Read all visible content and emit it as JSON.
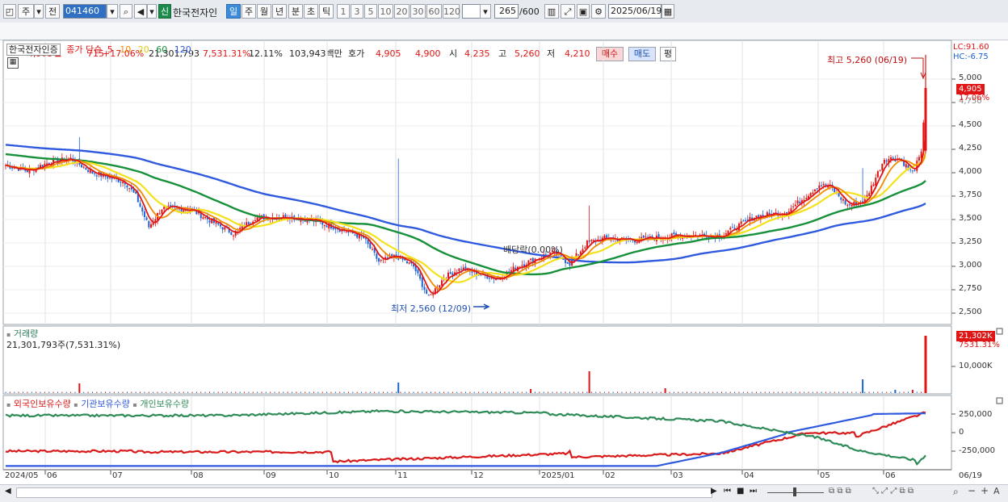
{
  "toolbar": {
    "period_day": "주",
    "prev": "전",
    "code": "041460",
    "new_badge": "신",
    "stock_name": "한국전자인",
    "periods": [
      "일",
      "주",
      "월",
      "년",
      "분",
      "초",
      "틱"
    ],
    "intervals": [
      "1",
      "3",
      "5",
      "10",
      "20",
      "30",
      "60",
      "120"
    ],
    "count": "265",
    "count_total": "/600",
    "date": "2025/06/19"
  },
  "quote": {
    "price": "4,905",
    "change": "715",
    "change_pct": "+17.06%",
    "volume": "21,301,793",
    "vol_ratio": "7,531.31%",
    "turnover": "12.11%",
    "amount": "103,943백만",
    "bid_label": "호가",
    "bid1": "4,905",
    "bid2": "4,900",
    "open_label": "시",
    "open": "4,235",
    "high_label": "고",
    "high": "5,260",
    "low_label": "저",
    "low": "4,210",
    "buy_label": "매수",
    "sell_label": "매도",
    "eval_label": "평"
  },
  "price_panel": {
    "name": "한국전자인증",
    "ma_label": "종가 단순",
    "ma_periods": [
      "5",
      "10",
      "20",
      "60",
      "120"
    ],
    "lc": "LC:91.60",
    "hc": "HC:-6.75",
    "high_note": "최고 5,260 (06/19)",
    "low_note": "최저 2,560 (12/09)",
    "dividend_note": "배당락(0.00%)",
    "cur_price_badge": "4,905",
    "cur_pct_badge": "17.06%",
    "y_ticks": [
      "5,000",
      "4,750",
      "4,500",
      "4,250",
      "4,000",
      "3,750",
      "3,500",
      "3,250",
      "3,000",
      "2,750",
      "2,500"
    ],
    "hidden_tick": "4,750"
  },
  "volume_panel": {
    "title": "거래량",
    "value": "21,301,793주(7,531.31%)",
    "badge_top": "21,302K",
    "badge_pct": "7531.31%",
    "y_tick": "10,000K"
  },
  "holding_panel": {
    "legend": [
      "외국인보유수량",
      "기관보유수량",
      "개인보유수량"
    ],
    "y_ticks": [
      "250,000",
      "0",
      "-250,000"
    ]
  },
  "x_axis": {
    "labels": [
      "2024/05",
      "06",
      "07",
      "08",
      "09",
      "10",
      "11",
      "12",
      "2025/01",
      "02",
      "03",
      "04",
      "05",
      "06",
      "06/19"
    ]
  },
  "colors": {
    "up": "#e01515",
    "down": "#1d63d6",
    "ma5": "#e01515",
    "ma10": "#f08a00",
    "ma20": "#f3e21a",
    "ma60": "#17903a",
    "ma120": "#2f5ae0",
    "foreign": "#d81a1a",
    "institution": "#2f5ae0",
    "individual": "#2e8b57"
  }
}
